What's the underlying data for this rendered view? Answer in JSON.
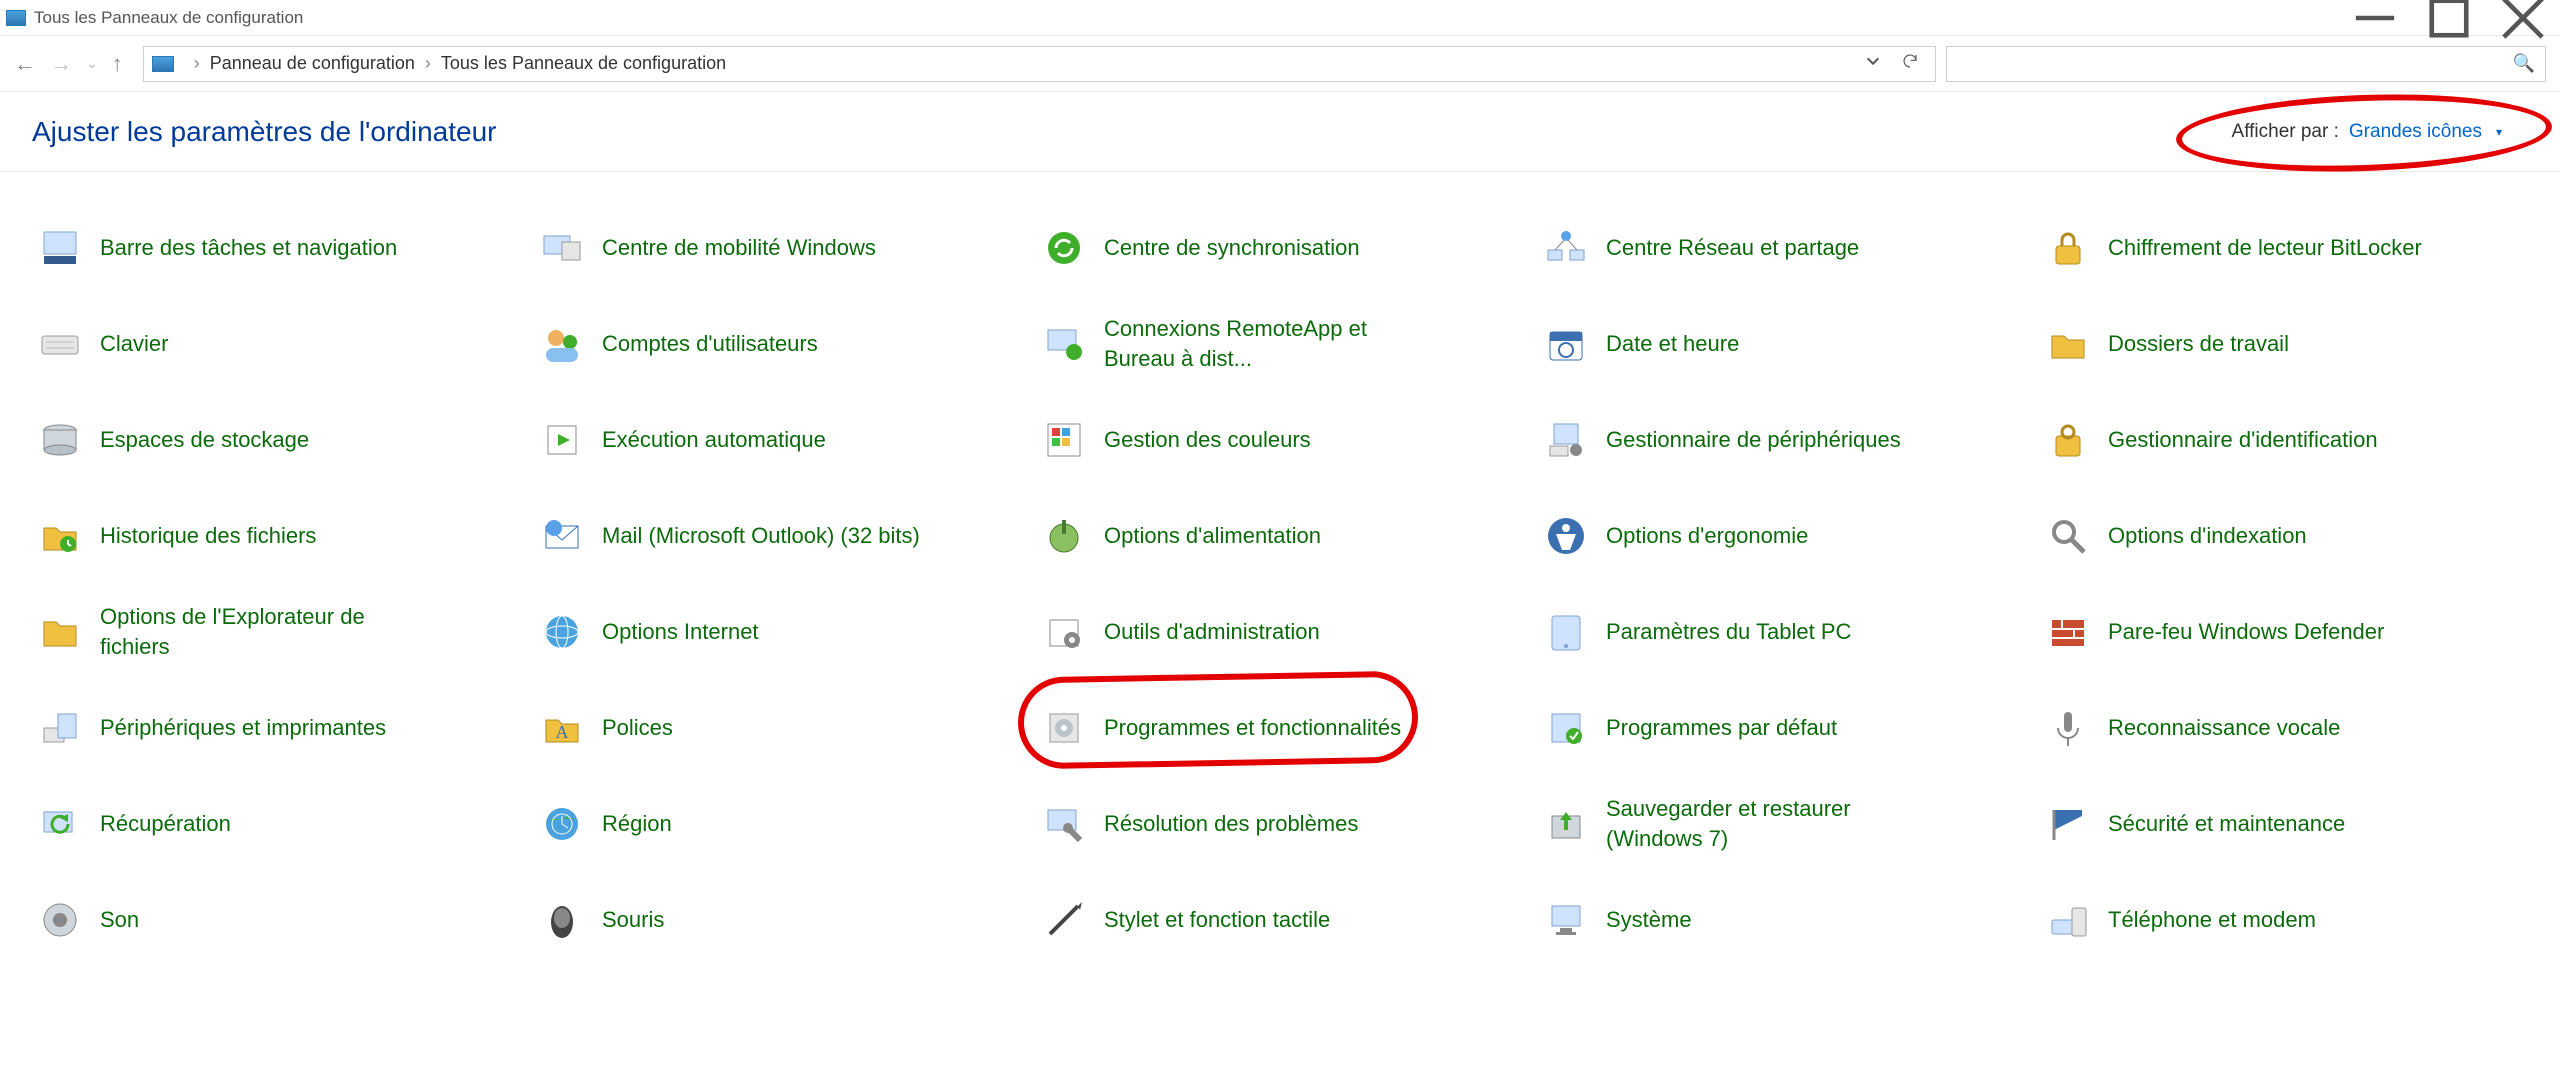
{
  "window": {
    "title": "Tous les Panneaux de configuration"
  },
  "breadcrumb": {
    "part1": "Panneau de configuration",
    "part2": "Tous les Panneaux de configuration"
  },
  "heading": "Ajuster les paramètres de l'ordinateur",
  "view_by_label": "Afficher par :",
  "view_by_value": "Grandes icônes",
  "items": [
    {
      "label": "Barre des tâches et navigation",
      "icon": "taskbar"
    },
    {
      "label": "Centre de mobilité Windows",
      "icon": "mobility"
    },
    {
      "label": "Centre de synchronisation",
      "icon": "sync"
    },
    {
      "label": "Centre Réseau et partage",
      "icon": "network"
    },
    {
      "label": "Chiffrement de lecteur BitLocker",
      "icon": "bitlocker"
    },
    {
      "label": "Clavier",
      "icon": "keyboard"
    },
    {
      "label": "Comptes d'utilisateurs",
      "icon": "users"
    },
    {
      "label": "Connexions RemoteApp et Bureau à dist...",
      "icon": "remoteapp"
    },
    {
      "label": "Date et heure",
      "icon": "datetime"
    },
    {
      "label": "Dossiers de travail",
      "icon": "workfolders"
    },
    {
      "label": "Espaces de stockage",
      "icon": "storage"
    },
    {
      "label": "Exécution automatique",
      "icon": "autoplay"
    },
    {
      "label": "Gestion des couleurs",
      "icon": "color"
    },
    {
      "label": "Gestionnaire de périphériques",
      "icon": "devicemgr"
    },
    {
      "label": "Gestionnaire d'identification",
      "icon": "credential"
    },
    {
      "label": "Historique des fichiers",
      "icon": "filehistory"
    },
    {
      "label": "Mail (Microsoft Outlook) (32 bits)",
      "icon": "mail"
    },
    {
      "label": "Options d'alimentation",
      "icon": "power"
    },
    {
      "label": "Options d'ergonomie",
      "icon": "ease"
    },
    {
      "label": "Options d'indexation",
      "icon": "indexing"
    },
    {
      "label": "Options de l'Explorateur de fichiers",
      "icon": "explorer"
    },
    {
      "label": "Options Internet",
      "icon": "internet"
    },
    {
      "label": "Outils d'administration",
      "icon": "admin"
    },
    {
      "label": "Paramètres du Tablet PC",
      "icon": "tablet"
    },
    {
      "label": "Pare-feu Windows Defender",
      "icon": "firewall"
    },
    {
      "label": "Périphériques et imprimantes",
      "icon": "devices"
    },
    {
      "label": "Polices",
      "icon": "fonts"
    },
    {
      "label": "Programmes et fonctionnalités",
      "icon": "programs",
      "highlighted": true
    },
    {
      "label": "Programmes par défaut",
      "icon": "defaults"
    },
    {
      "label": "Reconnaissance vocale",
      "icon": "speech"
    },
    {
      "label": "Récupération",
      "icon": "recovery"
    },
    {
      "label": "Région",
      "icon": "region"
    },
    {
      "label": "Résolution des problèmes",
      "icon": "troubleshoot"
    },
    {
      "label": "Sauvegarder et restaurer (Windows 7)",
      "icon": "backup"
    },
    {
      "label": "Sécurité et maintenance",
      "icon": "security"
    },
    {
      "label": "Son",
      "icon": "sound"
    },
    {
      "label": "Souris",
      "icon": "mouse"
    },
    {
      "label": "Stylet et fonction tactile",
      "icon": "pen"
    },
    {
      "label": "Système",
      "icon": "system"
    },
    {
      "label": "Téléphone et modem",
      "icon": "phone"
    }
  ]
}
